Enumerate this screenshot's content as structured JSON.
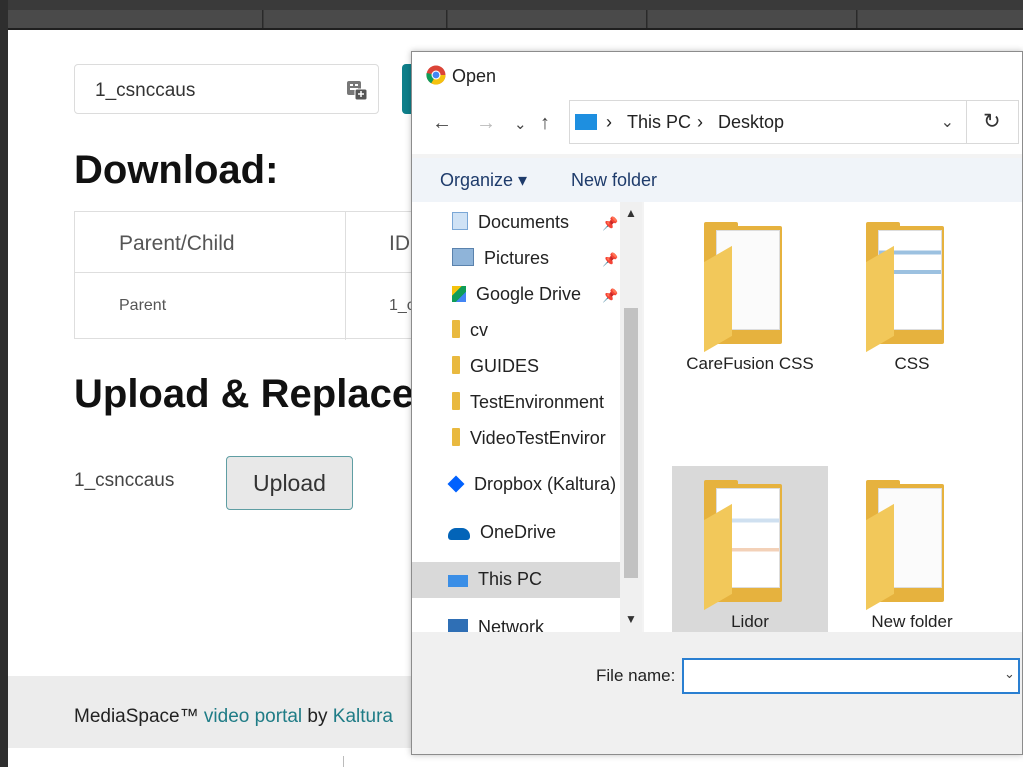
{
  "background_page": {
    "entry_id": "1_csnccaus",
    "download_heading": "Download:",
    "table": {
      "headers": [
        "Parent/Child",
        "ID"
      ],
      "rows": [
        [
          "Parent",
          "1_c"
        ]
      ]
    },
    "upload_heading": "Upload & Replace",
    "upload_entry_id": "1_csnccaus",
    "upload_button": "Upload",
    "footer": {
      "prefix": "MediaSpace™ ",
      "link1": "video portal",
      "middle": " by ",
      "link2": "Kaltura"
    }
  },
  "dialog": {
    "title": "Open",
    "nav": {
      "back": "←",
      "forward": "→",
      "recent": "⌄",
      "up": "↑",
      "refresh": "↻"
    },
    "address": {
      "crumbs": [
        "This PC",
        "Desktop"
      ],
      "sep": "›",
      "dropdown": "⌄"
    },
    "commands": {
      "organize": "Organize ▾",
      "new_folder": "New folder"
    },
    "nav_pane": [
      {
        "label": "Documents",
        "pinned": true
      },
      {
        "label": "Pictures",
        "pinned": true
      },
      {
        "label": "Google Drive",
        "pinned": true
      },
      {
        "label": "cv"
      },
      {
        "label": "GUIDES"
      },
      {
        "label": "TestEnvironment"
      },
      {
        "label": "VideoTestEnviror"
      },
      {
        "label": "Dropbox (Kaltura)"
      },
      {
        "label": "OneDrive"
      },
      {
        "label": "This PC"
      },
      {
        "label": "Network"
      }
    ],
    "files": [
      {
        "name": "CareFusion CSS"
      },
      {
        "name": "CSS"
      },
      {
        "name": "Lidor"
      },
      {
        "name": "New folder"
      }
    ],
    "file_name_label": "File name:",
    "file_name_value": "",
    "colors": {
      "accent": "#2a7fd1",
      "selection": "#d9d9d9",
      "folder": "#e6b23e"
    }
  }
}
